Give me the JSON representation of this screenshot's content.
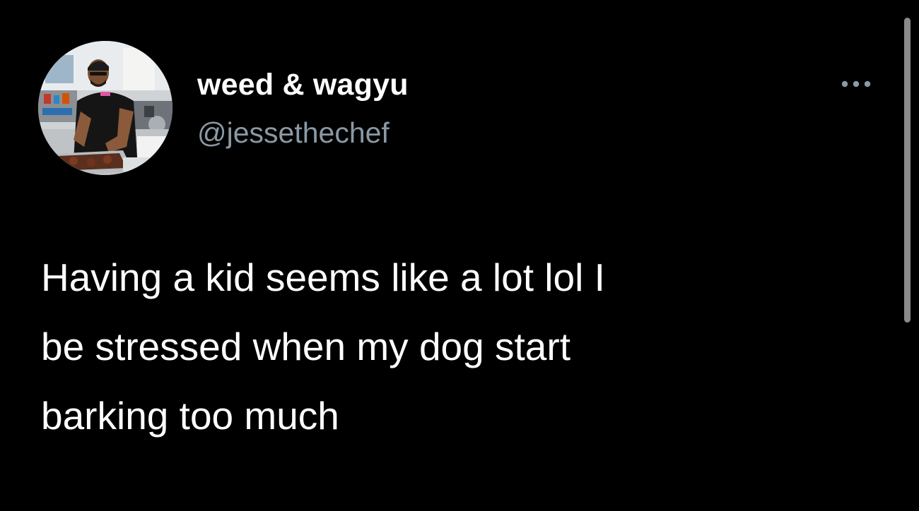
{
  "tweet": {
    "author": {
      "display_name": "weed & wagyu",
      "handle": "@jessethechef",
      "avatar_icon": "chef-profile-photo"
    },
    "more_icon": "more-horizontal-icon",
    "text_lines": [
      "Having a kid seems like a lot lol I",
      "be stressed when my dog start",
      "barking too much"
    ]
  },
  "colors": {
    "background": "#000000",
    "text": "#ffffff",
    "secondary_text": "#8b98a5",
    "scrollbar": "#8a8a8a"
  }
}
